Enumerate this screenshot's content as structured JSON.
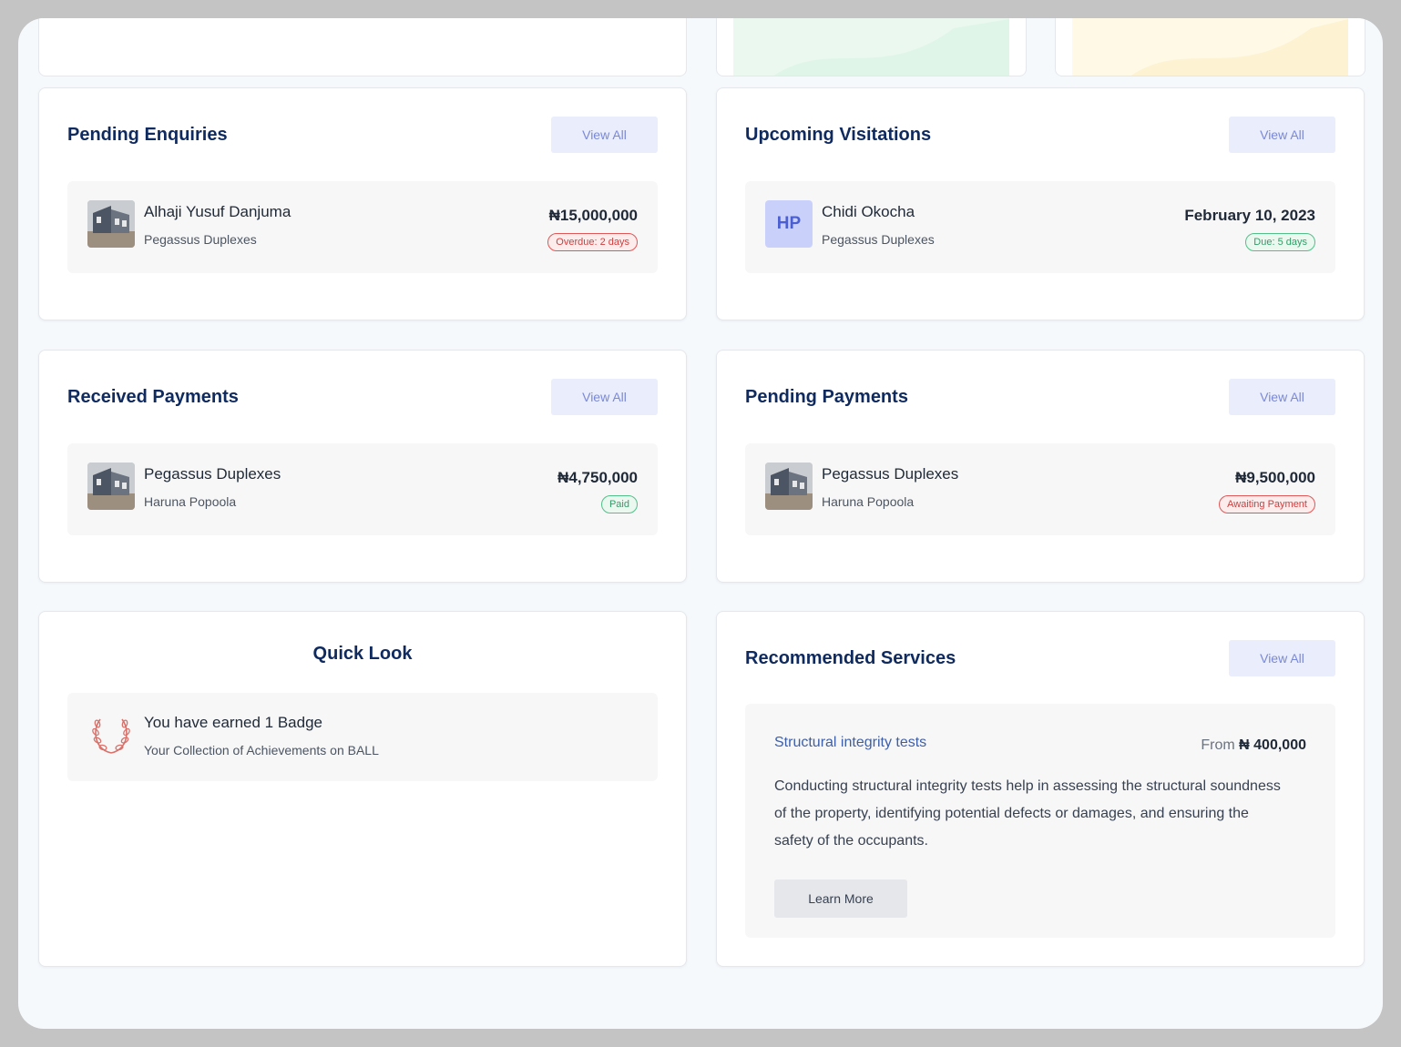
{
  "pending_enquiries": {
    "title": "Pending Enquiries",
    "view_all": "View All",
    "item": {
      "name": "Alhaji Yusuf Danjuma",
      "property": "Pegassus Duplexes",
      "amount": "₦15,000,000",
      "status": "Overdue: 2 days"
    }
  },
  "upcoming_visitations": {
    "title": "Upcoming Visitations",
    "view_all": "View All",
    "item": {
      "initials": "HP",
      "name": "Chidi Okocha",
      "property": "Pegassus Duplexes",
      "date": "February 10, 2023",
      "status": "Due: 5 days"
    }
  },
  "received_payments": {
    "title": "Received Payments",
    "view_all": "View All",
    "item": {
      "property": "Pegassus Duplexes",
      "payer": "Haruna Popoola",
      "amount": "₦4,750,000",
      "status": "Paid"
    }
  },
  "pending_payments": {
    "title": "Pending Payments",
    "view_all": "View All",
    "item": {
      "property": "Pegassus Duplexes",
      "payer": "Haruna Popoola",
      "amount": "₦9,500,000",
      "status": "Awaiting Payment"
    }
  },
  "quick_look": {
    "title": "Quick Look",
    "badge_title": "You have earned 1 Badge",
    "badge_sub": "Your Collection of Achievements on BALL"
  },
  "recommended_services": {
    "title": "Recommended Services",
    "view_all": "View All",
    "service": {
      "name": "Structural integrity tests",
      "price_prefix": "From",
      "price": "₦ 400,000",
      "description": "Conducting structural integrity tests help in assessing the structural soundness of the property, identifying potential defects or damages, and ensuring the safety of the occupants.",
      "cta": "Learn More"
    }
  },
  "colors": {
    "title": "#0f2a5e",
    "accent": "#7a89d6",
    "overdue": "#d13d3d",
    "success": "#2f9e66"
  }
}
